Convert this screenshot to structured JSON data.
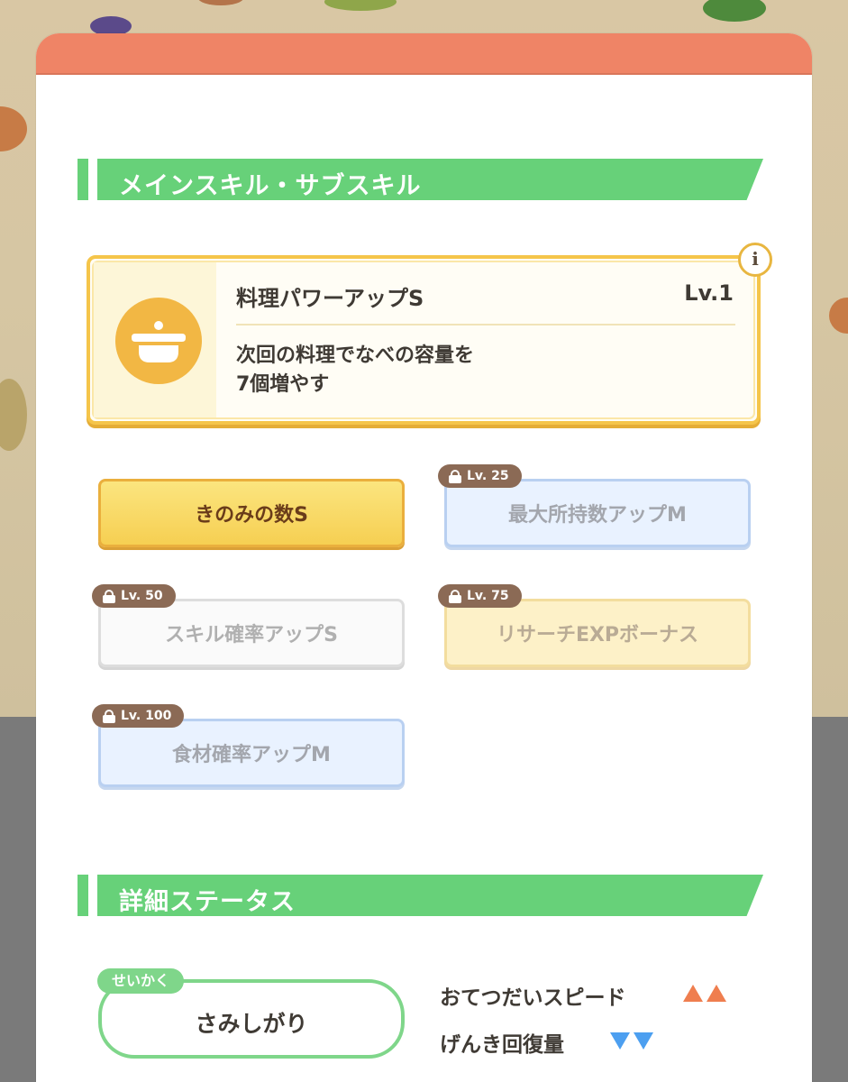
{
  "colors": {
    "header_coral": "#ef8466",
    "section_green": "#67d179",
    "gold_border": "#f5c54a",
    "lock_tag_brown": "#8b6a55",
    "stat_up_orange": "#ef7e4f",
    "stat_down_blue": "#4c9ff0"
  },
  "skills_section": {
    "title": "メインスキル・サブスキル"
  },
  "main_skill": {
    "icon": "cooking-pot-icon",
    "name": "料理パワーアップS",
    "level": "Lv.1",
    "description_line1": "次回の料理でなべの容量を",
    "description_line2": "7個増やす",
    "info_icon": "info-icon",
    "info_label": "i"
  },
  "sub_skills": [
    {
      "name": "きのみの数S",
      "locked": false,
      "style": "gold"
    },
    {
      "name": "最大所持数アップM",
      "locked": true,
      "unlock_level": "Lv. 25",
      "style": "blue"
    },
    {
      "name": "スキル確率アップS",
      "locked": true,
      "unlock_level": "Lv. 50",
      "style": "white"
    },
    {
      "name": "リサーチEXPボーナス",
      "locked": true,
      "unlock_level": "Lv. 75",
      "style": "yellow"
    },
    {
      "name": "食材確率アップM",
      "locked": true,
      "unlock_level": "Lv. 100",
      "style": "blue"
    }
  ],
  "status_section": {
    "title": "詳細ステータス"
  },
  "nature": {
    "tag": "せいかく",
    "value": "さみしがり"
  },
  "stat_effects": [
    {
      "label": "おてつだいスピード",
      "direction": "up",
      "count": 2
    },
    {
      "label": "げんき回復量",
      "direction": "down",
      "count": 2
    }
  ]
}
